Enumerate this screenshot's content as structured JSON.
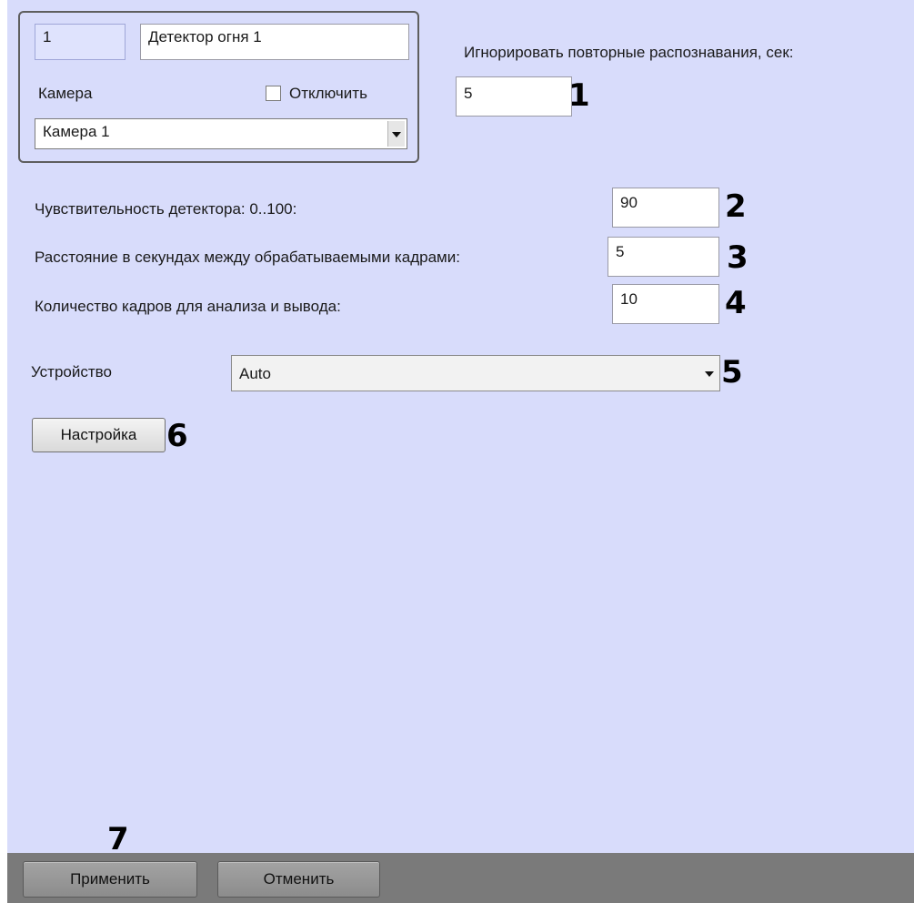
{
  "group": {
    "id_value": "1",
    "name_value": "Детектор огня 1",
    "camera_label": "Камера",
    "disable_label": "Отключить",
    "camera_select": "Камера 1"
  },
  "ignore": {
    "label": "Игнорировать повторные распознавания, сек:",
    "value": "5"
  },
  "sensitivity": {
    "label": "Чувствительность детектора: 0..100:",
    "value": "90"
  },
  "frame_interval": {
    "label": "Расстояние в секундах между обрабатываемыми кадрами:",
    "value": "5"
  },
  "frame_count": {
    "label": "Количество кадров для анализа и вывода:",
    "value": "10"
  },
  "device": {
    "label": "Устройство",
    "value": "Auto"
  },
  "setup_button": "Настройка",
  "apply_button": "Применить",
  "cancel_button": "Отменить",
  "markers": [
    "1",
    "2",
    "3",
    "4",
    "5",
    "6",
    "7"
  ]
}
